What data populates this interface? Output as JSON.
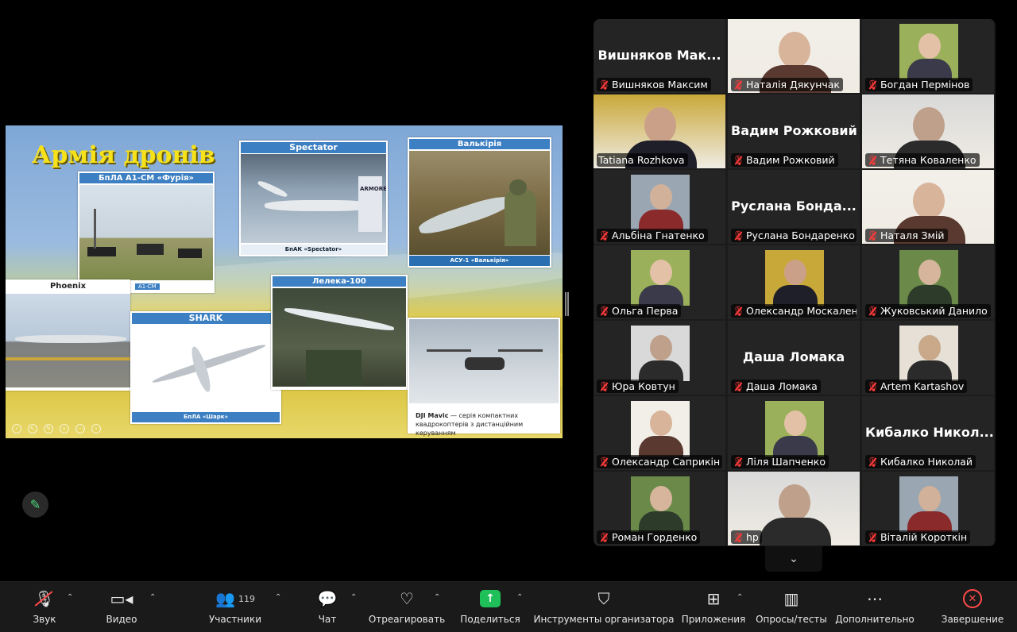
{
  "slide": {
    "title": "Армія дронів",
    "cards": {
      "furia": {
        "caption": "БпЛА А1-СМ «Фурія»",
        "sub": "А1-СМ"
      },
      "spectator": {
        "caption": "Spectator",
        "sub": "БпАК «Spectator»",
        "photo_text": "ARMORED"
      },
      "valkyrie": {
        "caption": "Валькірія",
        "sub": "АСУ-1 «Валькірія»"
      },
      "phoenix": {
        "caption": "Phoenix"
      },
      "shark": {
        "caption": "SHARK",
        "sub": "БпЛА «Шарк»"
      },
      "leleka": {
        "caption": "Лелека-100"
      },
      "mavic": {
        "name": "DJI Mavic",
        "desc": " — серія компактних квадрокоптерів з дистанційним керуванням"
      }
    }
  },
  "participants": [
    {
      "name": "Вишняков Максим",
      "display": "Вишняков Мак...",
      "video": false,
      "muted": true
    },
    {
      "name": "Наталія Дякунчак",
      "video": true,
      "muted": true
    },
    {
      "name": "Богдан Пермінов",
      "video": "avatar",
      "muted": true
    },
    {
      "name": "Tatiana Rozhkova",
      "video": true,
      "muted": false,
      "active": true
    },
    {
      "name": "Вадим Рожковий",
      "display": "Вадим Рожковий",
      "video": false,
      "muted": true
    },
    {
      "name": "Тетяна  Коваленко",
      "video": true,
      "muted": true
    },
    {
      "name": "Альбіна Гнатенко",
      "video": "avatar",
      "muted": true
    },
    {
      "name": "Руслана Бондаренко",
      "display": "Руслана Бонда...",
      "video": false,
      "muted": true
    },
    {
      "name": "Наталя Змій",
      "video": true,
      "muted": true
    },
    {
      "name": "Ольга Перва",
      "video": "avatar",
      "muted": true
    },
    {
      "name": "Олександр Москаленко",
      "label": "Олександр Москален...",
      "video": "avatar",
      "muted": true
    },
    {
      "name": "Жуковський Данило",
      "video": "avatar",
      "muted": true
    },
    {
      "name": "Юра Ковтун",
      "video": "avatar",
      "muted": true
    },
    {
      "name": "Даша Ломака",
      "display": "Даша Ломака",
      "video": false,
      "muted": true
    },
    {
      "name": "Artem Kartashov",
      "video": "avatar",
      "muted": true
    },
    {
      "name": "Олександр Саприкін",
      "video": "avatar",
      "muted": true
    },
    {
      "name": "Ліля Шапченко",
      "video": "avatar",
      "muted": true
    },
    {
      "name": "Кибалко Николай",
      "display": "Кибалко Никол...",
      "video": false,
      "muted": true
    },
    {
      "name": "Роман Горденко",
      "video": "avatar",
      "muted": true
    },
    {
      "name": "hp",
      "video": true,
      "muted": true
    },
    {
      "name": "Віталій Короткін",
      "video": "avatar",
      "muted": true
    }
  ],
  "toolbar": {
    "audio": "Звук",
    "video": "Видео",
    "participants": "Участники",
    "participants_count": "119",
    "chat": "Чат",
    "react": "Отреагировать",
    "share": "Поделиться",
    "host_tools": "Инструменты организатора",
    "apps": "Приложения",
    "polls": "Опросы/тесты",
    "more": "Дополнительно",
    "end": "Завершение"
  },
  "colors": {
    "accent_green": "#23d96b",
    "share_green": "#1fbf5a",
    "end_red": "#ff4a4a",
    "slide_title_yellow": "#f7e21a",
    "caption_blue": "#3c7fc2"
  }
}
